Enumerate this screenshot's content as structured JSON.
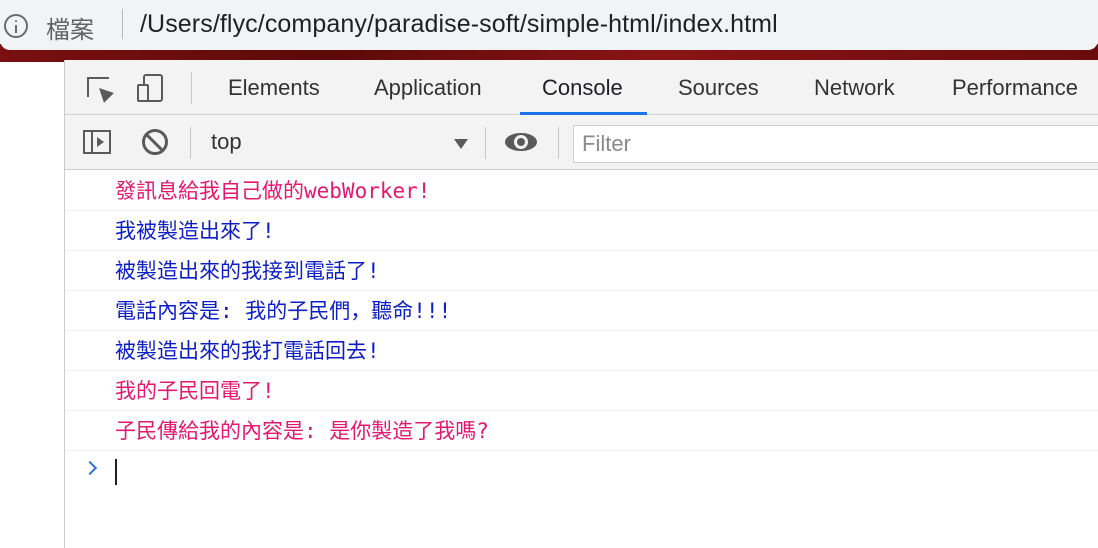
{
  "address_bar": {
    "protocol_label": "檔案",
    "url": "/Users/flyc/company/paradise-soft/simple-html/index.html"
  },
  "devtools": {
    "tabs": [
      {
        "label": "Elements",
        "active": false
      },
      {
        "label": "Application",
        "active": false
      },
      {
        "label": "Console",
        "active": true
      },
      {
        "label": "Sources",
        "active": false
      },
      {
        "label": "Network",
        "active": false
      },
      {
        "label": "Performance",
        "active": false
      }
    ],
    "toolbar": {
      "context": "top",
      "filter_placeholder": "Filter"
    },
    "console": {
      "colors": {
        "pink": "#e3186f",
        "blue": "#0d1fc4",
        "prompt": "#2b74e4"
      },
      "messages": [
        {
          "text": "發訊息給我自己做的webWorker!",
          "color": "pink"
        },
        {
          "text": "我被製造出來了!",
          "color": "blue"
        },
        {
          "text": "被製造出來的我接到電話了!",
          "color": "blue"
        },
        {
          "text": "電話內容是: 我的子民們，聽命!!!",
          "color": "blue"
        },
        {
          "text": "被製造出來的我打電話回去!",
          "color": "blue"
        },
        {
          "text": "我的子民回電了!",
          "color": "pink"
        },
        {
          "text": "子民傳給我的內容是: 是你製造了我嗎?",
          "color": "pink"
        }
      ]
    }
  }
}
